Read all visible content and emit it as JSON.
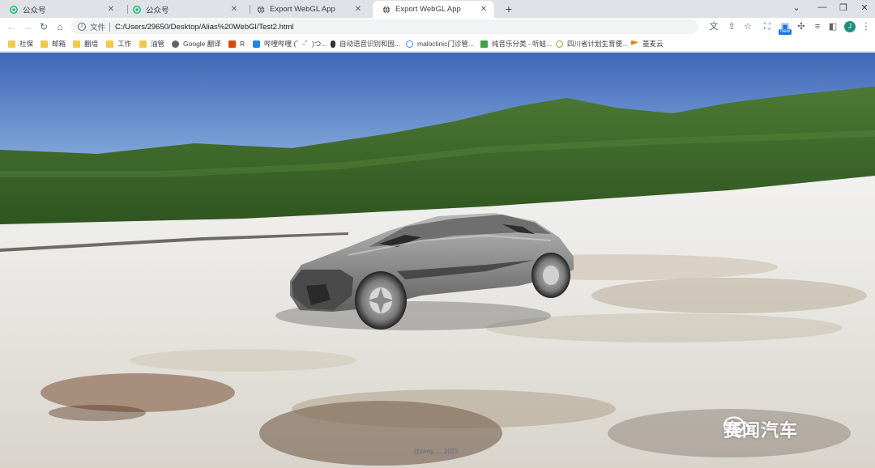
{
  "tabs": [
    {
      "label": "公众号",
      "icon": "wechat-icon",
      "active": false
    },
    {
      "label": "公众号",
      "icon": "wechat-icon",
      "active": false
    },
    {
      "label": "Export WebGL App",
      "icon": "globe-icon",
      "active": false
    },
    {
      "label": "Export WebGL App",
      "icon": "globe-icon",
      "active": true
    }
  ],
  "address_bar": {
    "scheme_label": "文件",
    "url": "C:/Users/29650/Desktop/Alias%20WebGl/Test2.html"
  },
  "extensions": {
    "new_badge": "New",
    "profile_initial": "J"
  },
  "bookmarks": [
    {
      "label": "社保",
      "icon": "folder-icon"
    },
    {
      "label": "邮箱",
      "icon": "folder-icon"
    },
    {
      "label": "翻墙",
      "icon": "folder-icon"
    },
    {
      "label": "工作",
      "icon": "folder-icon"
    },
    {
      "label": "油管",
      "icon": "folder-icon"
    },
    {
      "label": "Google 翻译",
      "icon": "globe-icon"
    },
    {
      "label": "R",
      "icon": "r-icon"
    },
    {
      "label": "哔哩哔哩 (゜-゜)つ...",
      "icon": "bilibili-icon"
    },
    {
      "label": "自动语音识别和固...",
      "icon": "mic-icon"
    },
    {
      "label": "maloclinic门诊管...",
      "icon": "clinic-icon"
    },
    {
      "label": "纯音乐分类 - 听蛙...",
      "icon": "music-icon"
    },
    {
      "label": "四川省计划生育便...",
      "icon": "health-icon"
    },
    {
      "label": "菱麦云",
      "icon": "flag-icon"
    }
  ],
  "scene": {
    "description_colors": {
      "sky_top": "#4a74c4",
      "sky_bottom": "#a7c3e6",
      "hills": "#3e6b2a",
      "ground": "#e9e9e6",
      "car": "#8a8a8a"
    },
    "credit_text": "@zeep … 2022"
  },
  "watermark": {
    "text": "赛闻汽车",
    "icon": "wechat-icon"
  }
}
